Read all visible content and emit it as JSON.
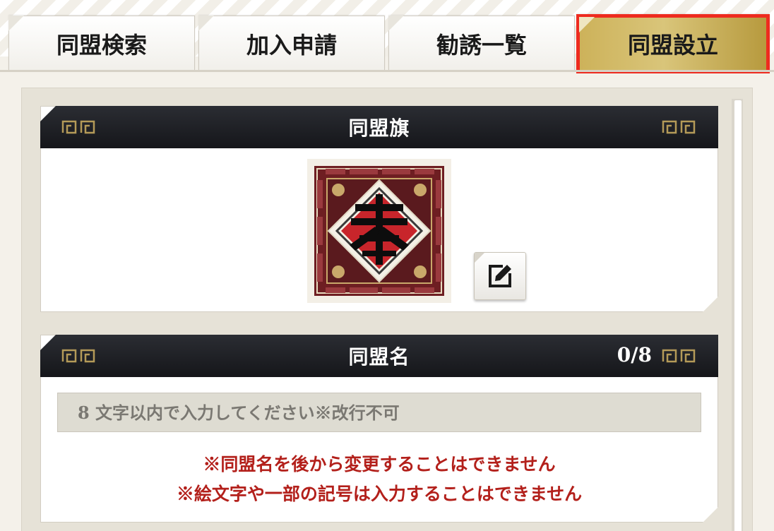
{
  "tabs": [
    {
      "label": "同盟検索",
      "active": false
    },
    {
      "label": "加入申請",
      "active": false
    },
    {
      "label": "勧誘一覧",
      "active": false
    },
    {
      "label": "同盟設立",
      "active": true
    }
  ],
  "banner_section": {
    "title": "同盟旗",
    "banner_icon": "alliance-banner-emblem",
    "edit_icon": "edit-pencil-icon"
  },
  "name_section": {
    "title": "同盟名",
    "counter": "0/8",
    "input_value": "",
    "input_placeholder": "8 文字以内で入力してください※改行不可",
    "warning_1": "※同盟名を後から変更することはできません",
    "warning_2": "※絵文字や一部の記号は入力することはできません"
  },
  "colors": {
    "active_tab_gold": "#c9ad55",
    "active_tab_highlight": "#ee2b1f",
    "header_dark": "#1f2025",
    "warning_red": "#b3201b"
  }
}
